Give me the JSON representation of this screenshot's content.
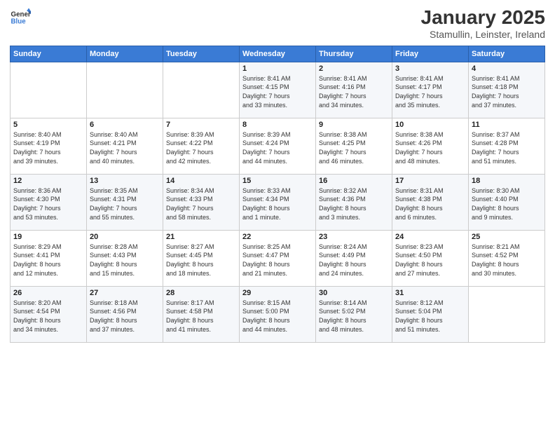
{
  "header": {
    "logo_line1": "General",
    "logo_line2": "Blue",
    "title": "January 2025",
    "subtitle": "Stamullin, Leinster, Ireland"
  },
  "days_of_week": [
    "Sunday",
    "Monday",
    "Tuesday",
    "Wednesday",
    "Thursday",
    "Friday",
    "Saturday"
  ],
  "weeks": [
    [
      {
        "day": "",
        "text": ""
      },
      {
        "day": "",
        "text": ""
      },
      {
        "day": "",
        "text": ""
      },
      {
        "day": "1",
        "text": "Sunrise: 8:41 AM\nSunset: 4:15 PM\nDaylight: 7 hours\nand 33 minutes."
      },
      {
        "day": "2",
        "text": "Sunrise: 8:41 AM\nSunset: 4:16 PM\nDaylight: 7 hours\nand 34 minutes."
      },
      {
        "day": "3",
        "text": "Sunrise: 8:41 AM\nSunset: 4:17 PM\nDaylight: 7 hours\nand 35 minutes."
      },
      {
        "day": "4",
        "text": "Sunrise: 8:41 AM\nSunset: 4:18 PM\nDaylight: 7 hours\nand 37 minutes."
      }
    ],
    [
      {
        "day": "5",
        "text": "Sunrise: 8:40 AM\nSunset: 4:19 PM\nDaylight: 7 hours\nand 39 minutes."
      },
      {
        "day": "6",
        "text": "Sunrise: 8:40 AM\nSunset: 4:21 PM\nDaylight: 7 hours\nand 40 minutes."
      },
      {
        "day": "7",
        "text": "Sunrise: 8:39 AM\nSunset: 4:22 PM\nDaylight: 7 hours\nand 42 minutes."
      },
      {
        "day": "8",
        "text": "Sunrise: 8:39 AM\nSunset: 4:24 PM\nDaylight: 7 hours\nand 44 minutes."
      },
      {
        "day": "9",
        "text": "Sunrise: 8:38 AM\nSunset: 4:25 PM\nDaylight: 7 hours\nand 46 minutes."
      },
      {
        "day": "10",
        "text": "Sunrise: 8:38 AM\nSunset: 4:26 PM\nDaylight: 7 hours\nand 48 minutes."
      },
      {
        "day": "11",
        "text": "Sunrise: 8:37 AM\nSunset: 4:28 PM\nDaylight: 7 hours\nand 51 minutes."
      }
    ],
    [
      {
        "day": "12",
        "text": "Sunrise: 8:36 AM\nSunset: 4:30 PM\nDaylight: 7 hours\nand 53 minutes."
      },
      {
        "day": "13",
        "text": "Sunrise: 8:35 AM\nSunset: 4:31 PM\nDaylight: 7 hours\nand 55 minutes."
      },
      {
        "day": "14",
        "text": "Sunrise: 8:34 AM\nSunset: 4:33 PM\nDaylight: 7 hours\nand 58 minutes."
      },
      {
        "day": "15",
        "text": "Sunrise: 8:33 AM\nSunset: 4:34 PM\nDaylight: 8 hours\nand 1 minute."
      },
      {
        "day": "16",
        "text": "Sunrise: 8:32 AM\nSunset: 4:36 PM\nDaylight: 8 hours\nand 3 minutes."
      },
      {
        "day": "17",
        "text": "Sunrise: 8:31 AM\nSunset: 4:38 PM\nDaylight: 8 hours\nand 6 minutes."
      },
      {
        "day": "18",
        "text": "Sunrise: 8:30 AM\nSunset: 4:40 PM\nDaylight: 8 hours\nand 9 minutes."
      }
    ],
    [
      {
        "day": "19",
        "text": "Sunrise: 8:29 AM\nSunset: 4:41 PM\nDaylight: 8 hours\nand 12 minutes."
      },
      {
        "day": "20",
        "text": "Sunrise: 8:28 AM\nSunset: 4:43 PM\nDaylight: 8 hours\nand 15 minutes."
      },
      {
        "day": "21",
        "text": "Sunrise: 8:27 AM\nSunset: 4:45 PM\nDaylight: 8 hours\nand 18 minutes."
      },
      {
        "day": "22",
        "text": "Sunrise: 8:25 AM\nSunset: 4:47 PM\nDaylight: 8 hours\nand 21 minutes."
      },
      {
        "day": "23",
        "text": "Sunrise: 8:24 AM\nSunset: 4:49 PM\nDaylight: 8 hours\nand 24 minutes."
      },
      {
        "day": "24",
        "text": "Sunrise: 8:23 AM\nSunset: 4:50 PM\nDaylight: 8 hours\nand 27 minutes."
      },
      {
        "day": "25",
        "text": "Sunrise: 8:21 AM\nSunset: 4:52 PM\nDaylight: 8 hours\nand 30 minutes."
      }
    ],
    [
      {
        "day": "26",
        "text": "Sunrise: 8:20 AM\nSunset: 4:54 PM\nDaylight: 8 hours\nand 34 minutes."
      },
      {
        "day": "27",
        "text": "Sunrise: 8:18 AM\nSunset: 4:56 PM\nDaylight: 8 hours\nand 37 minutes."
      },
      {
        "day": "28",
        "text": "Sunrise: 8:17 AM\nSunset: 4:58 PM\nDaylight: 8 hours\nand 41 minutes."
      },
      {
        "day": "29",
        "text": "Sunrise: 8:15 AM\nSunset: 5:00 PM\nDaylight: 8 hours\nand 44 minutes."
      },
      {
        "day": "30",
        "text": "Sunrise: 8:14 AM\nSunset: 5:02 PM\nDaylight: 8 hours\nand 48 minutes."
      },
      {
        "day": "31",
        "text": "Sunrise: 8:12 AM\nSunset: 5:04 PM\nDaylight: 8 hours\nand 51 minutes."
      },
      {
        "day": "",
        "text": ""
      }
    ]
  ]
}
